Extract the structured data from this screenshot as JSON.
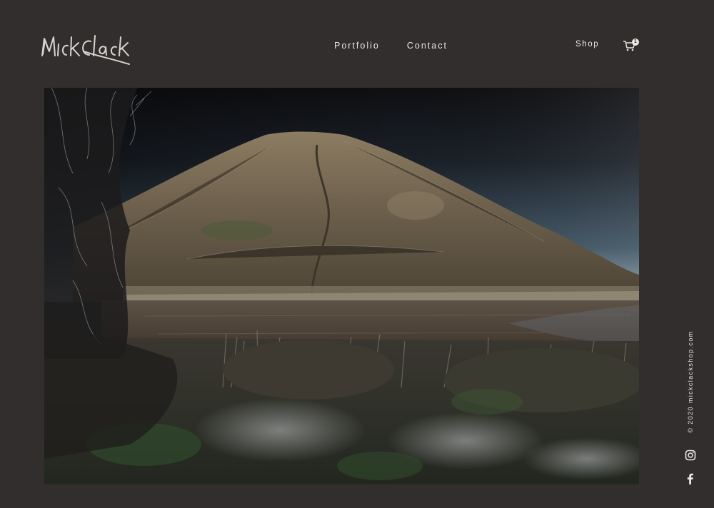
{
  "header": {
    "logo_text": "Mick Clack",
    "nav": {
      "portfolio": "Portfolio",
      "contact": "Contact"
    },
    "shop": "Shop",
    "cart_count": "1"
  },
  "main": {
    "photo_alt": "Landscape photograph of a conical grassy hill behind a lake, with frosty reeds in the foreground"
  },
  "footer": {
    "copyright": "© 2020 mickclackshop.com",
    "social": [
      "instagram-icon",
      "facebook-icon"
    ]
  },
  "colors": {
    "background": "#322e2d",
    "text": "#ebe7e4"
  }
}
